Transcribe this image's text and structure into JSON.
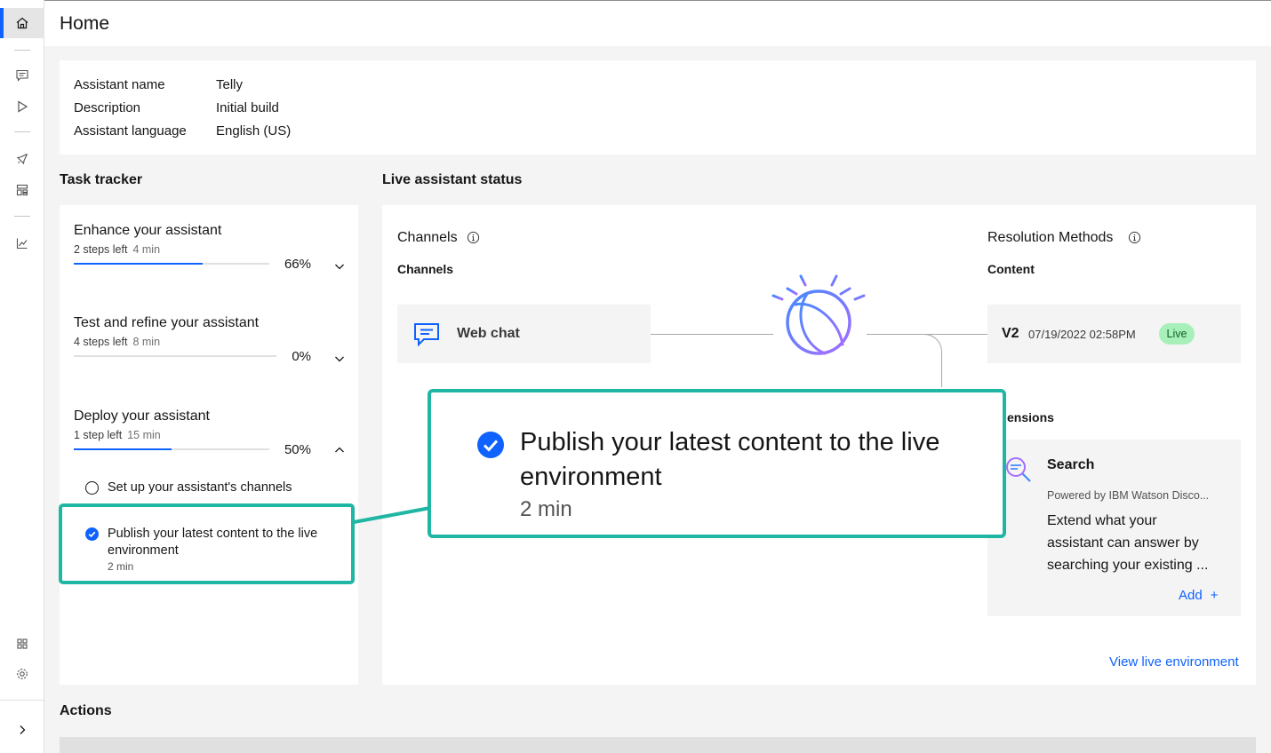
{
  "header": {
    "title": "Home"
  },
  "info": {
    "rows": [
      {
        "key": "Assistant name",
        "value": "Telly"
      },
      {
        "key": "Description",
        "value": "Initial build"
      },
      {
        "key": "Assistant language",
        "value": "English (US)"
      }
    ]
  },
  "tracker": {
    "title": "Task tracker",
    "tasks": [
      {
        "name": "Enhance your assistant",
        "steps": "2 steps left",
        "time": "4 min",
        "percent": "66%",
        "progress": 0.66
      },
      {
        "name": "Test and refine your assistant",
        "steps": "4 steps left",
        "time": "8 min",
        "percent": "0%",
        "progress": 0
      },
      {
        "name": "Deploy your assistant",
        "steps": "1 step left",
        "time": "15 min",
        "percent": "50%",
        "progress": 0.5
      }
    ],
    "subtasks": [
      {
        "label": "Set up your assistant's channels",
        "done": false
      },
      {
        "label": "Publish your latest content to the live",
        "label2": "environment",
        "time": "2 min",
        "done": true
      }
    ]
  },
  "status": {
    "title": "Live assistant status",
    "channels_title": "Channels",
    "channels_subtitle": "Channels",
    "web_chat": "Web chat",
    "resolution_title": "Resolution Methods",
    "content_label": "Content",
    "version": "V2",
    "version_date": "07/19/2022 02:58PM",
    "live_badge": "Live",
    "extensions_label": "ensions",
    "search_title": "Search",
    "search_powered": "Powered by IBM Watson Disco...",
    "search_desc_1": "Extend what your",
    "search_desc_2": "assistant can answer by",
    "search_desc_3": "searching your existing ...",
    "add_label": "Add",
    "view_live": "View live environment"
  },
  "callout": {
    "line1": "Publish your latest content to the live",
    "line2": "environment",
    "time": "2 min"
  },
  "actions": {
    "title": "Actions"
  },
  "colors": {
    "accent": "#0f62fe",
    "highlight": "#1fb6a3",
    "live": "#a7f0ba"
  }
}
